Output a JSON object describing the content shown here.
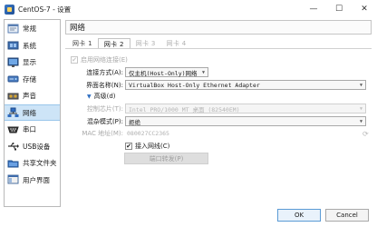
{
  "window": {
    "title": "CentOS-7 - 设置",
    "minimize": "—",
    "maximize": "☐",
    "close": "✕"
  },
  "sidebar": {
    "items": [
      {
        "label": "常规",
        "icon": "general-icon"
      },
      {
        "label": "系统",
        "icon": "system-icon"
      },
      {
        "label": "显示",
        "icon": "display-icon"
      },
      {
        "label": "存储",
        "icon": "storage-icon"
      },
      {
        "label": "声音",
        "icon": "audio-icon"
      },
      {
        "label": "网络",
        "icon": "network-icon",
        "selected": true
      },
      {
        "label": "串口",
        "icon": "serial-port-icon"
      },
      {
        "label": "USB设备",
        "icon": "usb-icon"
      },
      {
        "label": "共享文件夹",
        "icon": "shared-folder-icon"
      },
      {
        "label": "用户界面",
        "icon": "user-interface-icon"
      }
    ]
  },
  "main": {
    "section_title": "网络",
    "tabs": [
      "网卡 1",
      "网卡 2",
      "网卡 3",
      "网卡 4"
    ],
    "selected_tab": "网卡 2",
    "enable_adapter": {
      "label": "启用网络连接(E)",
      "checked": true,
      "enabled": false
    },
    "attached_to": {
      "label": "连接方式(A):",
      "value": "仅主机(Host-Only)网络"
    },
    "interface_name": {
      "label": "界面名称(N):",
      "value": "VirtualBox Host-Only Ethernet Adapter"
    },
    "advanced": {
      "label": "高级(d)",
      "expanded": true
    },
    "adapter_type": {
      "label": "控制芯片(T):",
      "value": "Intel PRO/1000 MT 桌面 (82540EM)"
    },
    "promiscuous_mode": {
      "label": "混杂模式(P):",
      "value": "拒绝"
    },
    "mac_address": {
      "label": "MAC 地址(M):",
      "value": "080027CC2365"
    },
    "cable_connected": {
      "label": "接入网线(C)",
      "checked": true
    },
    "port_forwarding": {
      "label": "端口转发(P)"
    }
  },
  "footer": {
    "ok": "OK",
    "cancel": "Cancel"
  },
  "colors": {
    "accent": "#3b78c6",
    "selected_bg": "#cde4f7"
  }
}
